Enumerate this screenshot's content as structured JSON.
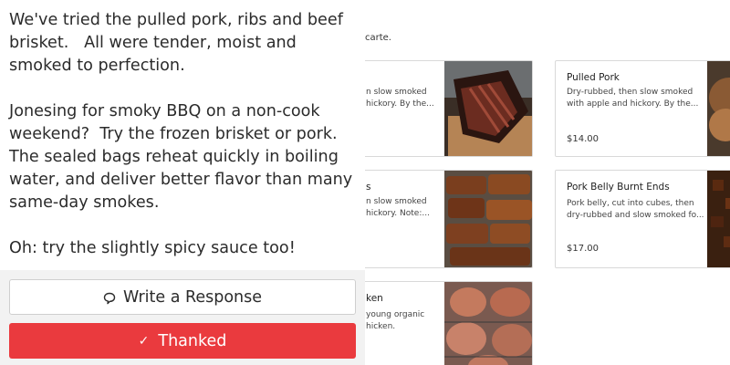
{
  "review": {
    "paragraphs": [
      "We've tried the pulled pork, ribs and beef brisket.   All were tender, moist and smoked to perfection.",
      "Jonesing for smoky BBQ on a non-cook weekend?  Try the frozen brisket or pork.  The sealed bags reheat quickly in boiling water, and deliver better flavor than many same-day smokes.",
      "Oh: try the slightly spicy sauce too!"
    ]
  },
  "actions": {
    "respond_label": "Write a Response",
    "thanked_label": "Thanked",
    "thanked_color": "#ea3a3e"
  },
  "menu": {
    "intro_fragment": "carte.",
    "items": [
      {
        "name": "",
        "desc_line1": "n slow smoked",
        "desc_line2": "hickory. By the...",
        "price": "",
        "photo": "brisket"
      },
      {
        "name": "Pulled Pork",
        "desc_line1": "Dry-rubbed, then slow smoked",
        "desc_line2": "with apple and hickory. By the...",
        "price": "$14.00",
        "photo": "pork"
      },
      {
        "name": "s",
        "desc_line1": "n slow smoked",
        "desc_line2": "hickory. Note:...",
        "price": "",
        "photo": "ribs"
      },
      {
        "name": "Pork Belly Burnt Ends",
        "desc_line1": "Pork belly, cut into cubes, then",
        "desc_line2": "dry-rubbed and slow smoked fo...",
        "price": "$17.00",
        "photo": "burnt-ends"
      },
      {
        "name": "ken",
        "desc_line1": "young organic",
        "desc_line2": "hicken.",
        "price": "",
        "photo": "chicken"
      }
    ]
  }
}
